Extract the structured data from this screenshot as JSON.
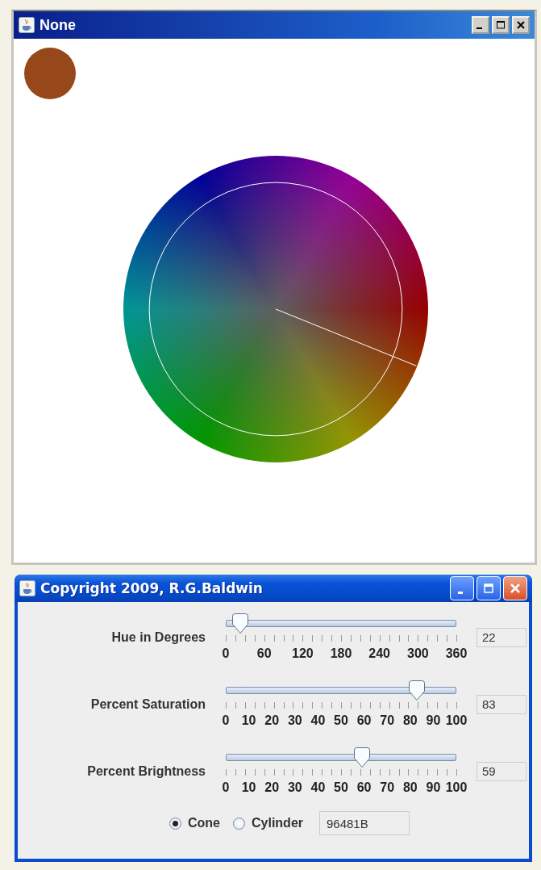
{
  "display_window": {
    "title": "None",
    "swatch": {
      "color": "#96481b"
    }
  },
  "control_window": {
    "title": "Copyright 2009, R.G.Baldwin",
    "sliders": [
      {
        "label": "Hue in Degrees",
        "level": 0.061,
        "value": "22",
        "tick_labels": [
          "0",
          "60",
          "120",
          "180",
          "240",
          "300",
          "360"
        ]
      },
      {
        "label": "Percent Saturation",
        "level": 0.83,
        "value": "83",
        "tick_labels": [
          "0",
          "10",
          "20",
          "30",
          "40",
          "50",
          "60",
          "70",
          "80",
          "90",
          "100"
        ]
      },
      {
        "label": "Percent Brightness",
        "level": 0.59,
        "value": "59",
        "tick_labels": [
          "0",
          "10",
          "20",
          "30",
          "40",
          "50",
          "60",
          "70",
          "80",
          "90",
          "100"
        ]
      }
    ],
    "shapes": [
      {
        "label": "Cone",
        "selected": true
      },
      {
        "label": "Cylinder",
        "selected": false
      }
    ],
    "hex_value": "96481B"
  }
}
